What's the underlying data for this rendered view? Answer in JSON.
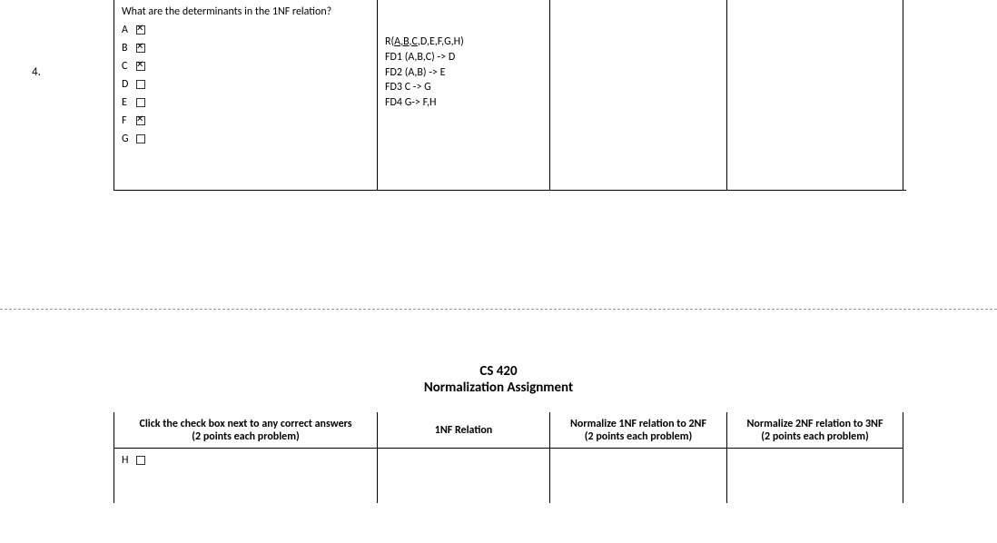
{
  "top": {
    "rowNumber": "4.",
    "question": "What are the determinants in the 1NF relation?",
    "options": [
      {
        "label": "A",
        "checked": true
      },
      {
        "label": "B",
        "checked": true
      },
      {
        "label": "C",
        "checked": true
      },
      {
        "label": "D",
        "checked": false
      },
      {
        "label": "E",
        "checked": false
      },
      {
        "label": "F",
        "checked": true
      },
      {
        "label": "G",
        "checked": false
      }
    ],
    "relationPrefix": "R(",
    "relationKey": "A,B,C",
    "relationRest": ",D,E,F,G,H)",
    "fd1": "FD1  (A,B,C) -> D",
    "fd2": "FD2  (A,B) -> E",
    "fd3": "FD3  C -> G",
    "fd4": "FD4  G-> F,H"
  },
  "bottom": {
    "titleLine1": "CS 420",
    "titleLine2": "Normalization Assignment",
    "headers": {
      "h1l1": "Click the check box next to any correct answers",
      "h1l2": "(2 points each problem)",
      "h2": "1NF Relation",
      "h3l1": "Normalize 1NF relation to 2NF",
      "h3l2": "(2 points each problem)",
      "h4l1": "Normalize 2NF relation to 3NF",
      "h4l2": "(2 points each problem)"
    },
    "optH": {
      "label": "H",
      "checked": false
    }
  }
}
